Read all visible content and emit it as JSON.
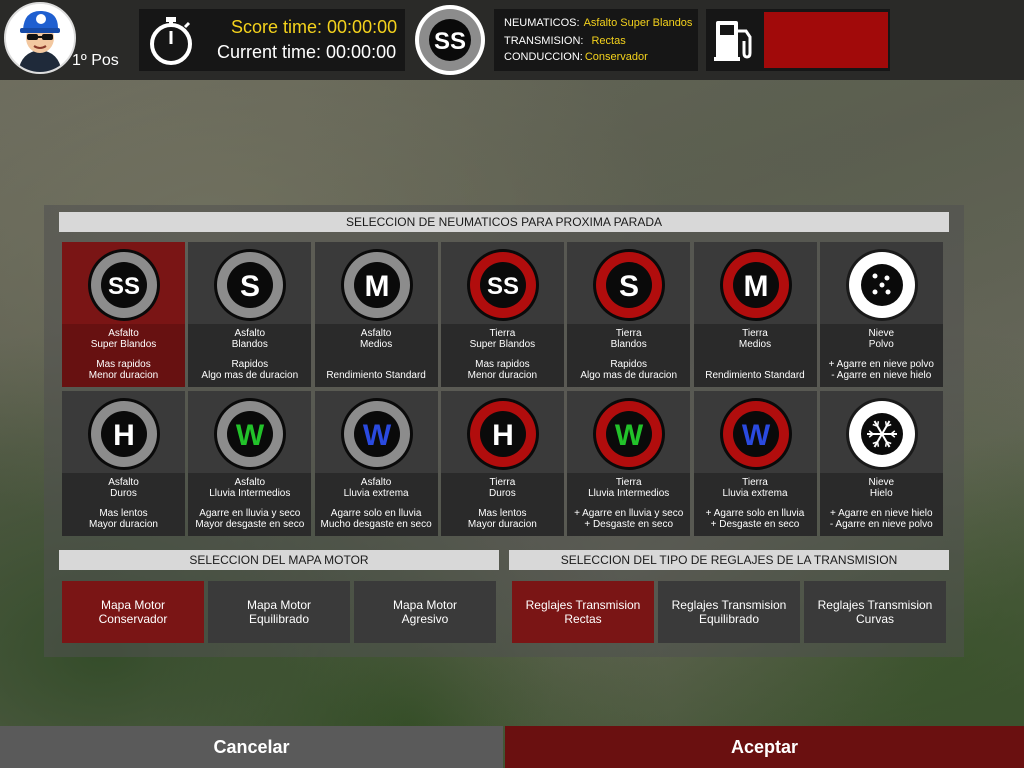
{
  "hud": {
    "position_label": "1º Pos",
    "score_time": "Score time: 00:00:00",
    "current_time": "Current time: 00:00:00",
    "current_tire_code": "SS",
    "neumaticos_label": "NEUMATICOS:",
    "neumaticos_value": "Asfalto Super Blandos",
    "transmision_label": "TRANSMISION:",
    "transmision_value": "Rectas",
    "conduccion_label": "CONDUCCION:",
    "conduccion_value": "Conservador",
    "fuel_color": "#a10a0a"
  },
  "tires": {
    "header": "SELECCION DE NEUMATICOS PARA PROXIMA PARADA",
    "items": [
      {
        "code": "SS",
        "ring": "gray",
        "letter_color": "#ffffff",
        "name1": "Asfalto",
        "name2": "Super Blandos",
        "desc1": "Mas rapidos",
        "desc2": "Menor duracion",
        "selected": true
      },
      {
        "code": "S",
        "ring": "gray",
        "letter_color": "#ffffff",
        "name1": "Asfalto",
        "name2": "Blandos",
        "desc1": "Rapidos",
        "desc2": "Algo mas de duracion",
        "selected": false
      },
      {
        "code": "M",
        "ring": "gray",
        "letter_color": "#ffffff",
        "name1": "Asfalto",
        "name2": "Medios",
        "desc1": "",
        "desc2": "Rendimiento Standard",
        "selected": false
      },
      {
        "code": "SS",
        "ring": "red",
        "letter_color": "#ffffff",
        "name1": "Tierra",
        "name2": "Super Blandos",
        "desc1": "Mas rapidos",
        "desc2": "Menor duracion",
        "selected": false
      },
      {
        "code": "S",
        "ring": "red",
        "letter_color": "#ffffff",
        "name1": "Tierra",
        "name2": "Blandos",
        "desc1": "Rapidos",
        "desc2": "Algo mas de duracion",
        "selected": false
      },
      {
        "code": "M",
        "ring": "red",
        "letter_color": "#ffffff",
        "name1": "Tierra",
        "name2": "Medios",
        "desc1": "",
        "desc2": "Rendimiento Standard",
        "selected": false
      },
      {
        "code": "dots",
        "ring": "white",
        "letter_color": "#ffffff",
        "name1": "Nieve",
        "name2": "Polvo",
        "desc1": "+ Agarre en nieve polvo",
        "desc2": "- Agarre en nieve hielo",
        "selected": false
      },
      {
        "code": "H",
        "ring": "gray",
        "letter_color": "#ffffff",
        "name1": "Asfalto",
        "name2": "Duros",
        "desc1": "Mas lentos",
        "desc2": "Mayor duracion",
        "selected": false
      },
      {
        "code": "W",
        "ring": "gray",
        "letter_color": "#22c22a",
        "name1": "Asfalto",
        "name2": "Lluvia Intermedios",
        "desc1": "Agarre en lluvia y seco",
        "desc2": "Mayor desgaste en seco",
        "selected": false
      },
      {
        "code": "W",
        "ring": "gray",
        "letter_color": "#2a4ae0",
        "name1": "Asfalto",
        "name2": "Lluvia extrema",
        "desc1": "Agarre solo en lluvia",
        "desc2": "Mucho desgaste en seco",
        "selected": false
      },
      {
        "code": "H",
        "ring": "red",
        "letter_color": "#ffffff",
        "name1": "Tierra",
        "name2": "Duros",
        "desc1": "Mas lentos",
        "desc2": "Mayor duracion",
        "selected": false
      },
      {
        "code": "W",
        "ring": "red",
        "letter_color": "#22c22a",
        "name1": "Tierra",
        "name2": "Lluvia Intermedios",
        "desc1": "+ Agarre en lluvia y seco",
        "desc2": "+ Desgaste en seco",
        "selected": false
      },
      {
        "code": "W",
        "ring": "red",
        "letter_color": "#2a4ae0",
        "name1": "Tierra",
        "name2": "Lluvia extrema",
        "desc1": "+ Agarre solo en lluvia",
        "desc2": "+ Desgaste en seco",
        "selected": false
      },
      {
        "code": "flake",
        "ring": "white",
        "letter_color": "#ffffff",
        "name1": "Nieve",
        "name2": "Hielo",
        "desc1": "+ Agarre en nieve hielo",
        "desc2": "- Agarre en nieve polvo",
        "selected": false
      }
    ]
  },
  "engine_map": {
    "header": "SELECCION DEL MAPA MOTOR",
    "options": [
      {
        "line1": "Mapa Motor",
        "line2": "Conservador",
        "selected": true
      },
      {
        "line1": "Mapa Motor",
        "line2": "Equilibrado",
        "selected": false
      },
      {
        "line1": "Mapa Motor",
        "line2": "Agresivo",
        "selected": false
      }
    ]
  },
  "transmission": {
    "header": "SELECCION DEL TIPO DE REGLAJES DE LA TRANSMISION",
    "options": [
      {
        "line1": "Reglajes Transmision",
        "line2": "Rectas",
        "selected": true
      },
      {
        "line1": "Reglajes Transmision",
        "line2": "Equilibrado",
        "selected": false
      },
      {
        "line1": "Reglajes Transmision",
        "line2": "Curvas",
        "selected": false
      }
    ]
  },
  "buttons": {
    "cancel": "Cancelar",
    "accept": "Aceptar"
  }
}
